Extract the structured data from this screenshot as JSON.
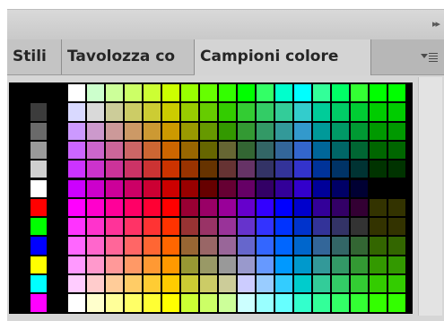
{
  "panel": {
    "collapse_icon": "double-chevron-right-icon",
    "menu_icon": "panel-menu-icon",
    "tabs": [
      {
        "label": "Stili",
        "active": false
      },
      {
        "label": "Tavolozza co",
        "active": false
      },
      {
        "label": "Campioni colore",
        "active": true
      }
    ]
  },
  "swatches": {
    "gray_column": [
      "#000000",
      "#3c3c3c",
      "#6a6a6a",
      "#9a9a9a",
      "#cfcfcf",
      "#ffffff",
      "#ff0000",
      "#00ff00",
      "#0000ff",
      "#ffff00",
      "#00ffff",
      "#ff00ff"
    ],
    "grid": [
      [
        "#ffffff",
        "#ccffcc",
        "#ccff99",
        "#ccff66",
        "#ccff33",
        "#ccff00",
        "#99ff00",
        "#66ff00",
        "#33ff00",
        "#00ff00",
        "#33ff66",
        "#00ffcc",
        "#00ffff",
        "#33ff99",
        "#00ff66",
        "#33ff33",
        "#00ff00",
        "#00ff00"
      ],
      [
        "#d9d9ff",
        "#d9d9d9",
        "#cccc99",
        "#cccc66",
        "#cccc33",
        "#cccc00",
        "#99cc00",
        "#66cc00",
        "#33cc00",
        "#33cc33",
        "#33cc66",
        "#33cc99",
        "#33cccc",
        "#00cc99",
        "#00cc66",
        "#00cc33",
        "#00cc00",
        "#00cc00"
      ],
      [
        "#cc99ff",
        "#cc99cc",
        "#cc9999",
        "#cc9966",
        "#cc9933",
        "#cc9900",
        "#999900",
        "#669900",
        "#339900",
        "#339933",
        "#339966",
        "#339999",
        "#3399cc",
        "#009999",
        "#009966",
        "#009933",
        "#009900",
        "#009900"
      ],
      [
        "#cc66ff",
        "#cc66cc",
        "#cc6699",
        "#cc6666",
        "#cc6633",
        "#cc6600",
        "#996600",
        "#666600",
        "#666633",
        "#336633",
        "#336666",
        "#336699",
        "#3366cc",
        "#006699",
        "#006666",
        "#006633",
        "#006600",
        "#006600"
      ],
      [
        "#cc33ff",
        "#cc33cc",
        "#cc3399",
        "#cc3366",
        "#cc3333",
        "#cc3300",
        "#993300",
        "#663300",
        "#663333",
        "#663366",
        "#333366",
        "#333399",
        "#3333cc",
        "#003399",
        "#003366",
        "#003333",
        "#003300",
        "#003300"
      ],
      [
        "#cc00ff",
        "#cc00cc",
        "#cc0099",
        "#cc0066",
        "#cc0033",
        "#cc0000",
        "#990000",
        "#660000",
        "#660033",
        "#660066",
        "#330066",
        "#330099",
        "#3300cc",
        "#000099",
        "#000066",
        "#000033",
        "#000000",
        "#000000"
      ],
      [
        "#ff00ff",
        "#ff00cc",
        "#ff0099",
        "#ff0066",
        "#ff0033",
        "#ff0000",
        "#990033",
        "#990066",
        "#990099",
        "#6600cc",
        "#3300ff",
        "#0000ff",
        "#0000cc",
        "#330099",
        "#330066",
        "#330033",
        "#333300",
        "#333300"
      ],
      [
        "#ff33ff",
        "#ff33cc",
        "#ff3399",
        "#ff3366",
        "#ff3333",
        "#ff3300",
        "#993333",
        "#993366",
        "#993399",
        "#6633cc",
        "#3333ff",
        "#0033ff",
        "#0033cc",
        "#333399",
        "#333366",
        "#333333",
        "#333300",
        "#333300"
      ],
      [
        "#ff66ff",
        "#ff66cc",
        "#ff6699",
        "#ff6666",
        "#ff6633",
        "#ff6600",
        "#996633",
        "#996666",
        "#996699",
        "#6666cc",
        "#3366ff",
        "#0066ff",
        "#0066cc",
        "#336699",
        "#336666",
        "#336633",
        "#336600",
        "#336600"
      ],
      [
        "#ff99ff",
        "#ff99cc",
        "#ff9999",
        "#ff9966",
        "#ff9933",
        "#ff9900",
        "#999933",
        "#999966",
        "#999999",
        "#9999cc",
        "#6699ff",
        "#0099ff",
        "#0099cc",
        "#339999",
        "#339966",
        "#339933",
        "#339900",
        "#339900"
      ],
      [
        "#ffccff",
        "#ffcccc",
        "#ffcc99",
        "#ffcc66",
        "#ffcc33",
        "#ffcc00",
        "#cccc33",
        "#cccc66",
        "#cccc99",
        "#ccccff",
        "#99ccff",
        "#33ccff",
        "#00cccc",
        "#33cc99",
        "#33cc66",
        "#33cc33",
        "#33cc00",
        "#33cc00"
      ],
      [
        "#ffffff",
        "#ffffcc",
        "#ffff99",
        "#ffff66",
        "#ffff33",
        "#ffff00",
        "#ccff33",
        "#ccff66",
        "#ccff99",
        "#ccffff",
        "#99ffff",
        "#66ffff",
        "#33ffcc",
        "#33ff99",
        "#33ff66",
        "#33ff33",
        "#33ff00",
        "#33ff00"
      ]
    ]
  }
}
